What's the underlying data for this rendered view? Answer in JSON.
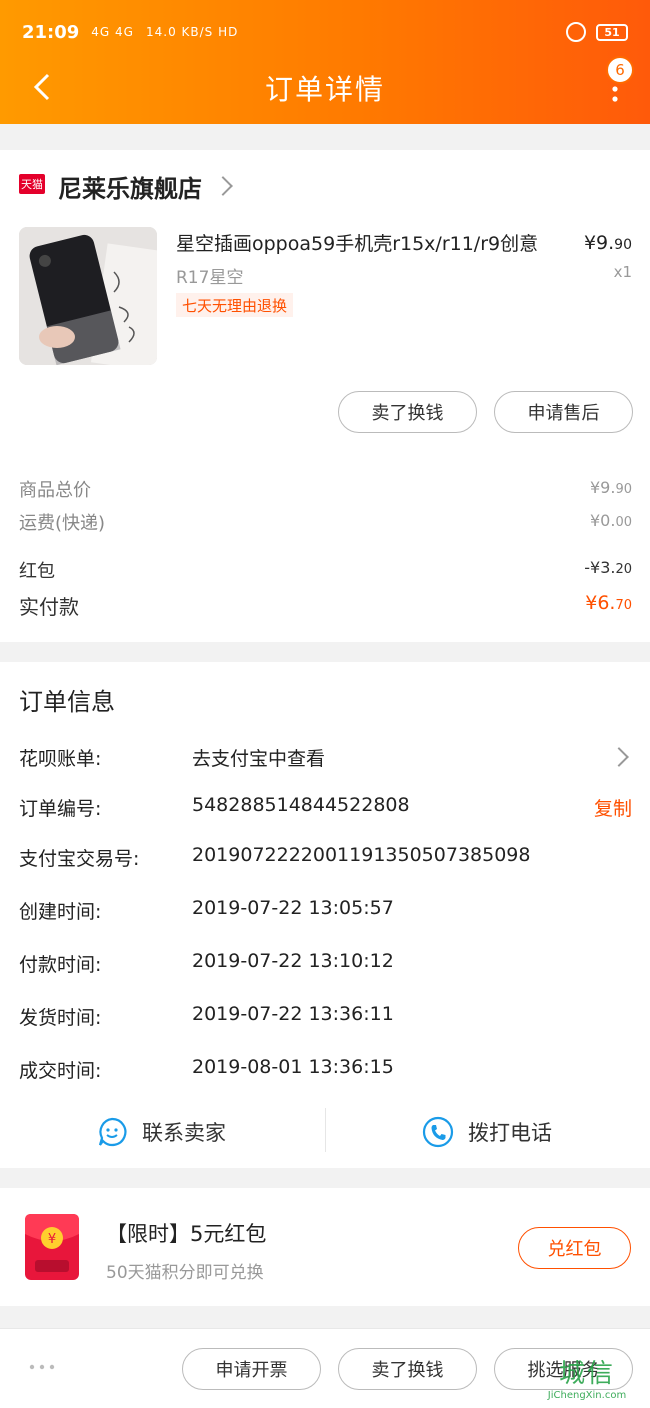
{
  "status_bar": {
    "time": "21:09",
    "network": "4G 4G",
    "speed": "14.0 KB/S HD",
    "battery": "51"
  },
  "nav": {
    "title": "订单详情",
    "badge": "6"
  },
  "store": {
    "name": "尼莱乐旗舰店",
    "logo": "天猫",
    "product": {
      "title": "星空插画oppoa59手机壳r15x/r11/r9创意",
      "price_main": "¥9.",
      "price_cents": "90",
      "sku": "R17星空",
      "qty": "x1",
      "tag": "七天无理由退换"
    },
    "buttons": {
      "sell": "卖了换钱",
      "aftersale": "申请售后"
    },
    "summary": {
      "goods_label": "商品总价",
      "goods_main": "¥9.",
      "goods_cents": "90",
      "shipping_label": "运费(快递)",
      "shipping_main": "¥0.",
      "shipping_cents": "00",
      "redpack_label": "红包",
      "redpack_main": "-¥3.",
      "redpack_cents": "20",
      "paid_label": "实付款",
      "paid_main": "¥6.",
      "paid_cents": "70"
    }
  },
  "order_info": {
    "title": "订单信息",
    "rows": [
      {
        "label": "花呗账单:",
        "value": "去支付宝中查看"
      },
      {
        "label": "订单编号:",
        "value": "548288514844522808"
      },
      {
        "label": "支付宝交易号:",
        "value": "2019072222001191350507385098"
      },
      {
        "label": "创建时间:",
        "value": "2019-07-22 13:05:57"
      },
      {
        "label": "付款时间:",
        "value": "2019-07-22 13:10:12"
      },
      {
        "label": "发货时间:",
        "value": "2019-07-22 13:36:11"
      },
      {
        "label": "成交时间:",
        "value": "2019-08-01 13:36:15"
      }
    ],
    "copy_label": "复制",
    "contact_seller": "联系卖家",
    "call_phone": "拨打电话"
  },
  "promo": {
    "title": "【限时】5元红包",
    "subtitle": "50天猫积分即可兑换",
    "button": "兑红包",
    "icon_glyph": "¥"
  },
  "bottom_bar": {
    "invoice": "申请开票",
    "sell": "卖了换钱",
    "service": "挑选服务",
    "watermark_main": "城信",
    "watermark_sub": "JiChengXin.com"
  },
  "colors": {
    "accent": "#ff5000",
    "header_start": "#ff9a00",
    "header_end": "#ff5a0a"
  }
}
